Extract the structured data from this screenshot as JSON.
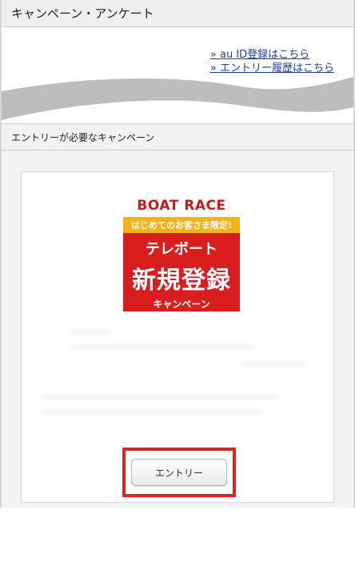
{
  "campaign_header": {
    "title": "キャンペーン・アンケート"
  },
  "links": {
    "au_id": "» au ID登録はこちら",
    "entry_history": "» エントリー履歴はこちら"
  },
  "entry_section": {
    "title": "エントリーが必要なキャンペーン"
  },
  "banner": {
    "brand": "BOAT RACE",
    "tag": "はじめてのお客さま限定!",
    "line1": "テレボート",
    "line2": "新規登録",
    "line3": "キャンペーン"
  },
  "card": {
    "entry_button": "エントリー"
  },
  "colors": {
    "link": "#1a3e9e",
    "banner_red": "#d81e1e",
    "banner_yellow": "#f4b21b",
    "highlight_red": "#e2231a"
  }
}
